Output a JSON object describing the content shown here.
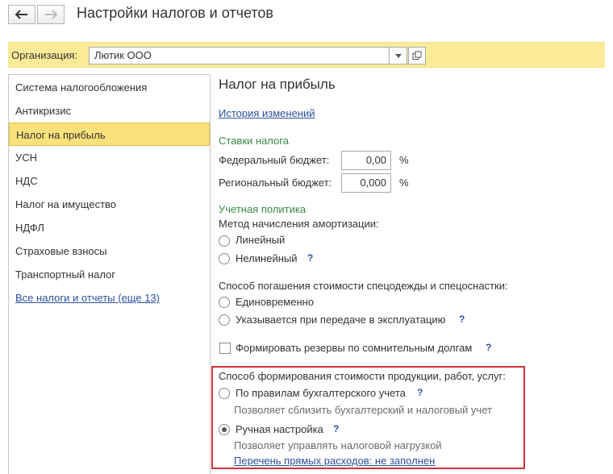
{
  "window": {
    "title": "Настройки налогов и отчетов",
    "back_icon": "arrow-left-icon",
    "forward_icon": "arrow-right-icon"
  },
  "org": {
    "label": "Организация:",
    "value": "Лютик ООО"
  },
  "sidebar": {
    "items": [
      {
        "label": "Система налогообложения"
      },
      {
        "label": "Антикризис"
      },
      {
        "label": "Налог на прибыль",
        "active": true
      },
      {
        "label": "УСН"
      },
      {
        "label": "НДС"
      },
      {
        "label": "Налог на имущество"
      },
      {
        "label": "НДФЛ"
      },
      {
        "label": "Страховые взносы"
      },
      {
        "label": "Транспортный налог"
      }
    ],
    "all_link": "Все налоги и отчеты (еще 13)"
  },
  "main": {
    "title": "Налог на прибыль",
    "history_link": "История изменений",
    "rates": {
      "heading": "Ставки налога",
      "federal_label": "Федеральный бюджет:",
      "federal_value": "0,00",
      "regional_label": "Региональный бюджет:",
      "regional_value": "0,000",
      "percent": "%"
    },
    "policy": {
      "heading": "Учетная политика",
      "depr_label": "Метод начисления амортизации:",
      "depr_options": [
        "Линейный",
        "Нелинейный"
      ],
      "work_label": "Способ погашения стоимости спецодежды и спецоснастки:",
      "work_options": [
        "Единовременно",
        "Указывается при передаче в эксплуатацию"
      ],
      "reserve_label": "Формировать резервы по сомнительным долгам",
      "cost_label": "Способ формирования стоимости продукции, работ, услуг:",
      "cost_options": [
        {
          "label": "По правилам бухгалтерского учета",
          "hint": "Позволяет сблизить бухгалтерский и налоговый учет",
          "selected": false
        },
        {
          "label": "Ручная настройка",
          "hint": "Позволяет управлять налоговой нагрузкой",
          "selected": true
        }
      ],
      "direct_costs_link": "Перечень прямых расходов: не заполнен"
    },
    "help": "?"
  },
  "colors": {
    "accent_yellow": "#fbeb98",
    "active_item": "#fbe17b",
    "link": "#2d4f9e",
    "heading_green": "#3c8a45",
    "highlight_red": "#d0313d"
  }
}
